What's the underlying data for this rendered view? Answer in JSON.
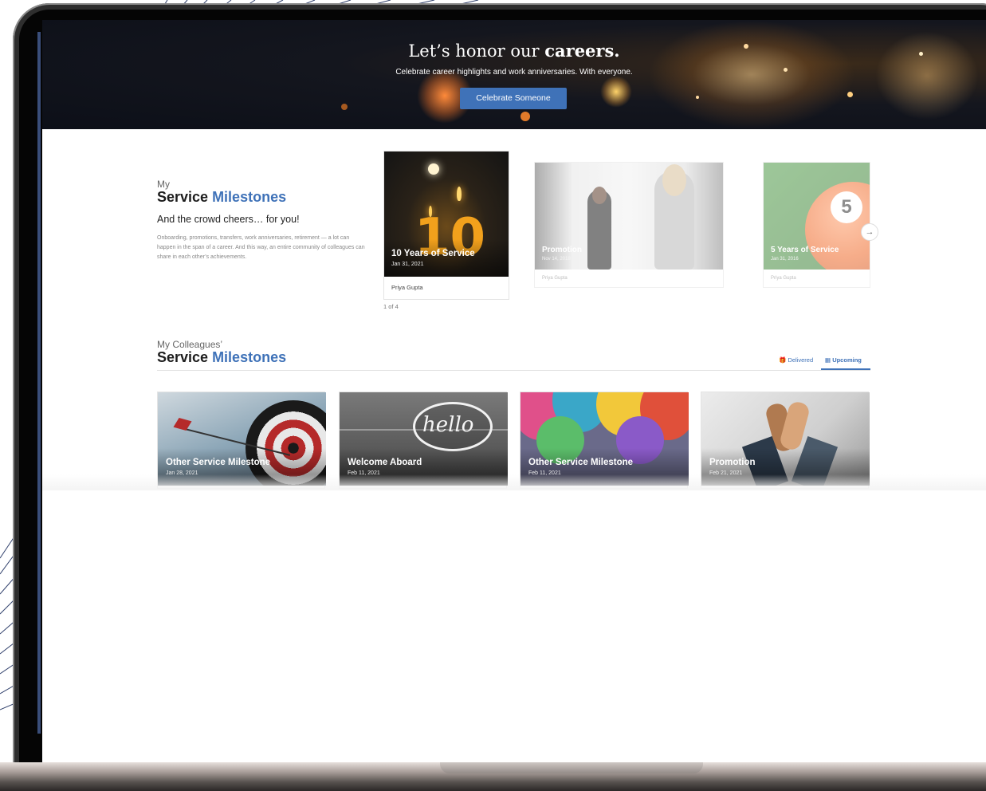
{
  "hero": {
    "title_prefix": "Let’s honor our ",
    "title_bold": "careers.",
    "subtitle": "Celebrate career highlights and work anniversaries. With everyone.",
    "button": "Celebrate Someone"
  },
  "my_milestones": {
    "kicker": "My",
    "title_main": "Service ",
    "title_accent": "Milestones",
    "tagline": "And the crowd cheers… for you!",
    "description": "Onboarding, promotions, transfers, work anniversaries, retirement — a lot can happen in the span of a career. And this way, an entire community of colleagues can share in each other’s achievements.",
    "cards": [
      {
        "title": "10 Years of Service",
        "date": "Jan 31, 2021",
        "person": "Priya Gupta",
        "image_icon": "birthday-candles-10",
        "badge": "10"
      },
      {
        "title": "Promotion",
        "date": "Nov 14, 2018",
        "person": "Priya Gupta",
        "image_icon": "whiteboard-meeting"
      },
      {
        "title": "5 Years of Service",
        "date": "Jan 31, 2016",
        "person": "Priya Gupta",
        "image_icon": "pool-ball-5",
        "badge": "5"
      }
    ],
    "pager": "1 of 4",
    "next_icon": "arrow-right-icon"
  },
  "colleagues": {
    "kicker": "My Colleagues’",
    "title_main": "Service ",
    "title_accent": "Milestones",
    "tabs": [
      {
        "label": "Delivered",
        "icon": "gift-icon",
        "active": false
      },
      {
        "label": "Upcoming",
        "icon": "calendar-icon",
        "active": true
      }
    ],
    "cards": [
      {
        "title": "Other Service Milestone",
        "date": "Jan 28, 2021",
        "image_icon": "target-arrow"
      },
      {
        "title": "Welcome Aboard",
        "date": "Feb 11, 2021",
        "image_icon": "hello-speech-bubble",
        "bubble_text": "hello"
      },
      {
        "title": "Other Service Milestone",
        "date": "Feb 11, 2021",
        "image_icon": "balloons"
      },
      {
        "title": "Promotion",
        "date": "Feb 21, 2021",
        "image_icon": "high-five"
      }
    ]
  },
  "colors": {
    "accent": "#3f72b8",
    "hero_bg": "#0c0f18",
    "text_dark": "#1d1d1d"
  }
}
